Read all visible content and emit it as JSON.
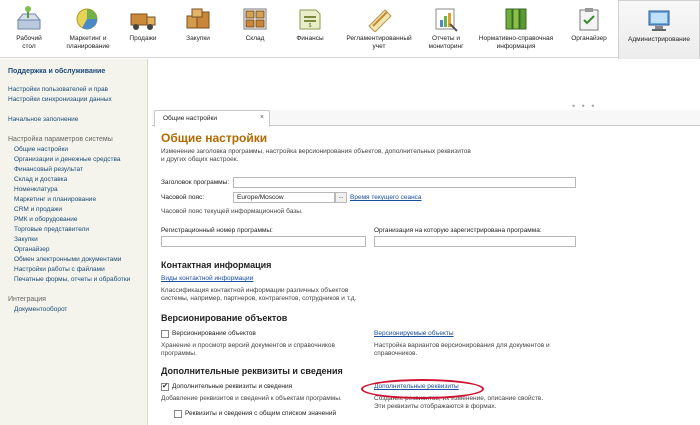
{
  "sections": [
    {
      "label": "Рабочий\nстол",
      "icon": "desktop-icon"
    },
    {
      "label": "Маркетинг и\nпланирование",
      "icon": "marketing-icon"
    },
    {
      "label": "Продажи",
      "icon": "sales-icon"
    },
    {
      "label": "Закупки",
      "icon": "purchases-icon"
    },
    {
      "label": "Склад",
      "icon": "warehouse-icon"
    },
    {
      "label": "Финансы",
      "icon": "finance-icon"
    },
    {
      "label": "Регламентированный\nучет",
      "icon": "accounting-icon"
    },
    {
      "label": "Отчеты и\nмониторинг",
      "icon": "reports-icon"
    },
    {
      "label": "Нормативно-справочная\nинформация",
      "icon": "reference-icon"
    },
    {
      "label": "Органайзер",
      "icon": "organizer-icon"
    },
    {
      "label": "Администрирование",
      "icon": "admin-icon"
    }
  ],
  "sidebar": {
    "group1_title": "Поддержка и обслуживание",
    "group1_items": [
      "Настройки пользователей и прав",
      "Настройки синхронизации данных"
    ],
    "initial_fill": "Начальное заполнение",
    "group2_title": "Настройка параметров системы",
    "group2_items": [
      "Общие настройки",
      "Организации и денежные средства",
      "Финансовый результат",
      "Склад и доставка",
      "Номенклатура",
      "Маркетинг и планирование",
      "CRM и продажи",
      "РМК и оборудование",
      "Торговые представители",
      "Закупки",
      "Органайзер",
      "Обмен электронными документами",
      "Настройки работы с файлами",
      "Печатные формы, отчеты и обработки"
    ],
    "group3_title": "Интеграция",
    "group3_items": [
      "Документооборот"
    ]
  },
  "tab": {
    "label": "Общие настройки",
    "close": "×"
  },
  "main": {
    "title": "Общие настройки",
    "description": "Изменение заголовка программы, настройка версионирования объектов, дополнительных реквизитов\nи других общих настроек.",
    "program_title_label": "Заголовок программы:",
    "program_title_value": "",
    "timezone_label": "Часовой пояс:",
    "timezone_value": "Europe/Moscow",
    "timezone_btn": "...",
    "session_time_link": "Время текущего сеанса",
    "timezone_hint": "Часовой пояс текущей информационной базы.",
    "reg_number_label": "Регистрационный номер программы:",
    "reg_org_label": "Организация на которую зарегистрирована программа:",
    "contact_title": "Контактная информация",
    "contact_link": "Виды контактной информации",
    "contact_desc": "Классификация контактной информации различных объектов\nсистемы, например, партнеров, контрагентов, сотрудников и т.д.",
    "versioning_title": "Версионирование объектов",
    "versioning_check": "Версионирование объектов",
    "versioning_desc": "Хранение и просмотр версий документов и справочников\nпрограммы.",
    "versioning_link": "Версионируемые объекты",
    "versioning_link_desc": "Настройка вариантов версионирования для документов и\nсправочников.",
    "additional_title": "Дополнительные реквизиты и сведения",
    "additional_check": "Дополнительные реквизиты и сведения",
    "additional_check_mark": "✔",
    "additional_desc": "Добавление реквизитов и сведений к объектам программы.",
    "additional_link": "Дополнительные реквизиты",
    "additional_link_desc": "Создание реквизитов, их изменение, описание свойств.\nЭти реквизиты отображаются в формах.",
    "common_list_check": "Реквизиты и сведения с общим списком значений"
  }
}
